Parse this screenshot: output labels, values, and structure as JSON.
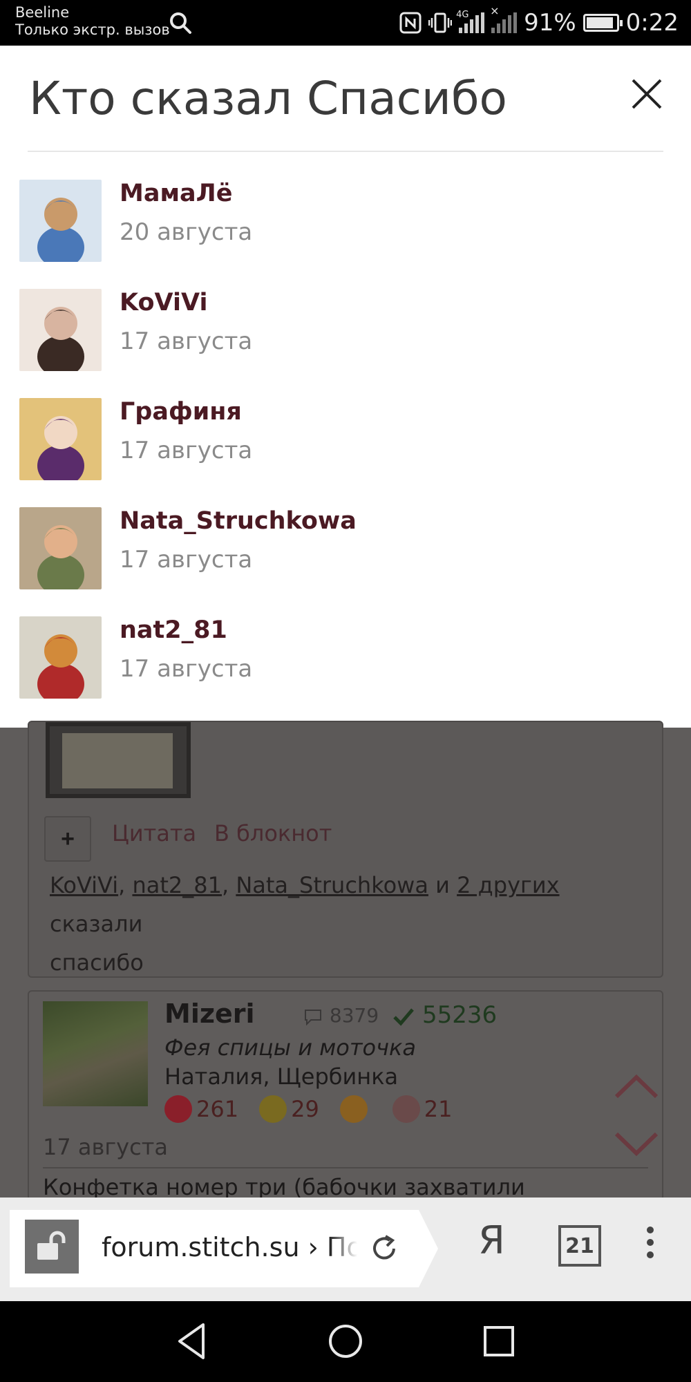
{
  "status_bar": {
    "carrier": "Beeline",
    "carrier_note": "Только экстр. вызов",
    "network": "4G",
    "battery": "91%",
    "battery_level": 0.91,
    "time": "0:22",
    "icons": [
      "search-icon",
      "nfc-icon",
      "vibrate-icon",
      "signal-icon",
      "no-signal-icon",
      "battery-icon"
    ]
  },
  "modal": {
    "title": "Кто сказал Спасибо",
    "close_icon": "close-icon",
    "users": [
      {
        "name": "МамаЛё",
        "date": "20 августа",
        "avatar_colors": [
          "#d9e4ef",
          "#4a78b8",
          "#c99a6a"
        ]
      },
      {
        "name": "KoViVi",
        "date": "17 августа",
        "avatar_colors": [
          "#efe6df",
          "#3a2a24",
          "#d8b4a0"
        ]
      },
      {
        "name": "Графиня",
        "date": "17 августа",
        "avatar_colors": [
          "#e3c27a",
          "#5a2c6b",
          "#f1d8c4"
        ]
      },
      {
        "name": "Nata_Struchkowa",
        "date": "17 августа",
        "avatar_colors": [
          "#b9a68a",
          "#6a7a4a",
          "#e2b08a"
        ]
      },
      {
        "name": "nat2_81",
        "date": "17 августа",
        "avatar_colors": [
          "#d8d4c8",
          "#b02a2a",
          "#d28a3a"
        ]
      }
    ]
  },
  "background_page": {
    "actions": {
      "plus": "+",
      "quote": "Цитата",
      "notebook": "В блокнот"
    },
    "thanks": {
      "user1": "KoViVi",
      "sep1": ", ",
      "user2": "nat2_81",
      "sep2": ", ",
      "user3": "Nata_Struchkowa",
      "and": " и ",
      "others": "2 других",
      "said": " сказали",
      "thanks_word": "спасибо"
    },
    "post": {
      "author": "Mizeri",
      "comments": "8379",
      "checks": "55236",
      "title": "Фея спицы и моточка",
      "location": "Наталия, Щербинка",
      "badges": [
        {
          "icon": "heart-badge-icon",
          "value": "261",
          "color": "#8a1f2a"
        },
        {
          "icon": "scissors-badge-icon",
          "value": "29",
          "color": "#7a6a20"
        },
        {
          "icon": "bag-badge-icon",
          "value": "",
          "color": "#8a6020"
        },
        {
          "icon": "yarn-badge-icon",
          "value": "21",
          "color": "#6a4a4a"
        }
      ],
      "date": "17 августа",
      "text": "Конфетка номер три (бабочки захватили"
    }
  },
  "browser_bar": {
    "url": "forum.stitch.su › По",
    "yandex_label": "Я",
    "tabs_count": "21",
    "icons": [
      "lock-icon",
      "reload-icon",
      "yandex-icon",
      "tabs-icon",
      "menu-icon"
    ]
  },
  "nav_bar": {
    "icons": [
      "back-icon",
      "home-icon",
      "recents-icon"
    ]
  }
}
